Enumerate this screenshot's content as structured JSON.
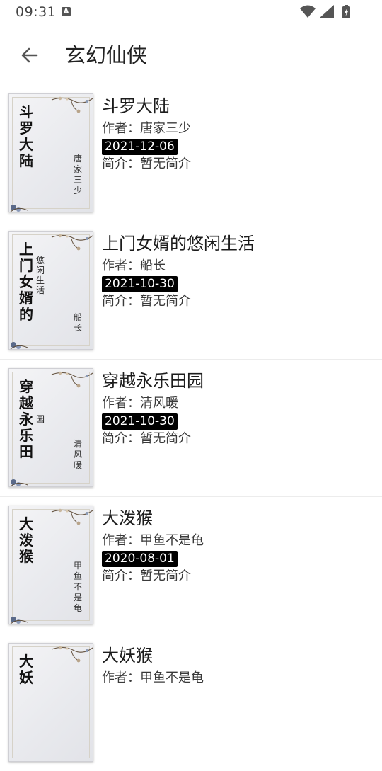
{
  "status_bar": {
    "time": "09:31",
    "notification_icon": "A"
  },
  "header": {
    "title": "玄幻仙侠"
  },
  "books": [
    {
      "name": "斗罗大陆",
      "cover_title": "斗罗大陆",
      "cover_sub": "",
      "cover_author": "唐家三少",
      "author_line": "作者：唐家三少",
      "date": "2021-12-06",
      "intro": "简介：暂无简介"
    },
    {
      "name": "上门女婿的悠闲生活",
      "cover_title": "上门女婿的",
      "cover_sub": "悠闲生活",
      "cover_author": "船长",
      "author_line": "作者：船长",
      "date": "2021-10-30",
      "intro": "简介：暂无简介"
    },
    {
      "name": "穿越永乐田园",
      "cover_title": "穿越永乐田",
      "cover_sub": "园",
      "cover_author": "清风暖",
      "author_line": "作者：清风暖",
      "date": "2021-10-30",
      "intro": "简介：暂无简介"
    },
    {
      "name": "大泼猴",
      "cover_title": "大泼猴",
      "cover_sub": "",
      "cover_author": "甲鱼不是龟",
      "author_line": "作者：甲鱼不是龟",
      "date": "2020-08-01",
      "intro": "简介：暂无简介"
    },
    {
      "name": "大妖猴",
      "cover_title": "大妖",
      "cover_sub": "",
      "cover_author": "",
      "author_line": "作者：甲鱼不是龟",
      "date": "",
      "intro": ""
    }
  ]
}
